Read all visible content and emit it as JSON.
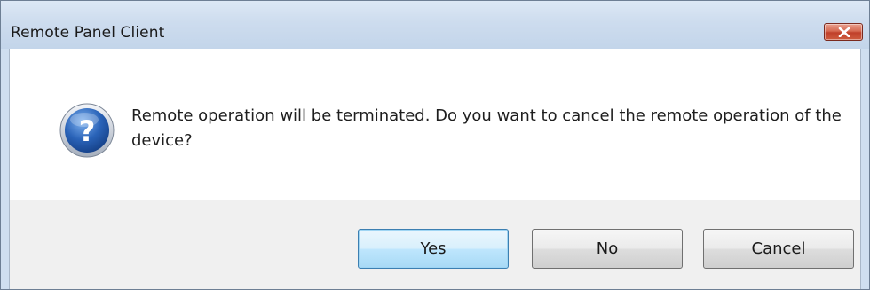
{
  "window": {
    "title": "Remote Panel Client"
  },
  "dialog": {
    "icon": "question-icon",
    "message": "Remote operation will be terminated. Do you want to cancel the remote operation of the device?"
  },
  "buttons": {
    "yes_label": "Yes",
    "no_mnemonic": "N",
    "no_rest": "o",
    "cancel_label": "Cancel"
  },
  "colors": {
    "close_button": "#c0402a",
    "default_button_border": "#3c7fb1",
    "icon_blue": "#2a63b8"
  }
}
